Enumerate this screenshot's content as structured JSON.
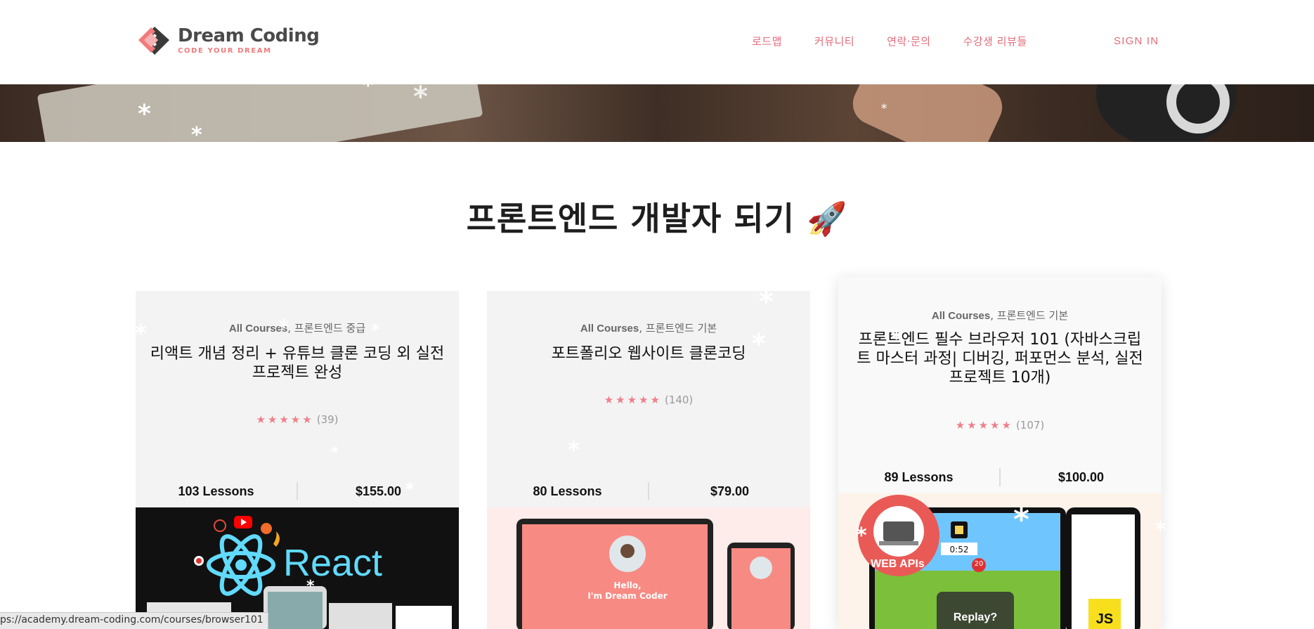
{
  "brand": {
    "title": "Dream Coding",
    "subtitle": "CODE YOUR DREAM",
    "color": "#ef7b7b"
  },
  "nav": {
    "items": [
      "로드맵",
      "커뮤니티",
      "연락·문의",
      "수강생 리뷰들"
    ],
    "signin": "SIGN IN",
    "color": "#e46a78"
  },
  "section_title": "프론트엔드 개발자 되기 🚀",
  "courses": [
    {
      "category_main": "All Courses",
      "category_sub": "프론트엔드 중급",
      "title": "리액트 개념 정리 + 유튜브 클론 코딩 외 실전 프로젝트 완성",
      "stars": "★★★★★",
      "reviews": "(39)",
      "lessons": "103 Lessons",
      "price": "$155.00",
      "thumb_text": "React"
    },
    {
      "category_main": "All Courses",
      "category_sub": "프론트엔드 기본",
      "title": "포트폴리오 웹사이트 클론코딩",
      "stars": "★★★★★",
      "reviews": "(140)",
      "lessons": "80 Lessons",
      "price": "$79.00",
      "thumb_hello": "Hello,",
      "thumb_name": "I'm Dream Coder"
    },
    {
      "category_main": "All Courses",
      "category_sub": "프론트엔드 기본",
      "title": "프론트엔드 필수 브라우저 101 (자바스크립트 마스터 과정| 디버깅, 퍼포먼스 분석, 실전 프로젝트 10개)",
      "stars": "★★★★★",
      "reviews": "(107)",
      "lessons": "89 Lessons",
      "price": "$100.00",
      "badge": "WEB APIs",
      "timer": "0:52",
      "count": "20",
      "replay": "Replay?",
      "js": "JS"
    }
  ],
  "status_url": "ps://academy.dream-coding.com/courses/browser101"
}
